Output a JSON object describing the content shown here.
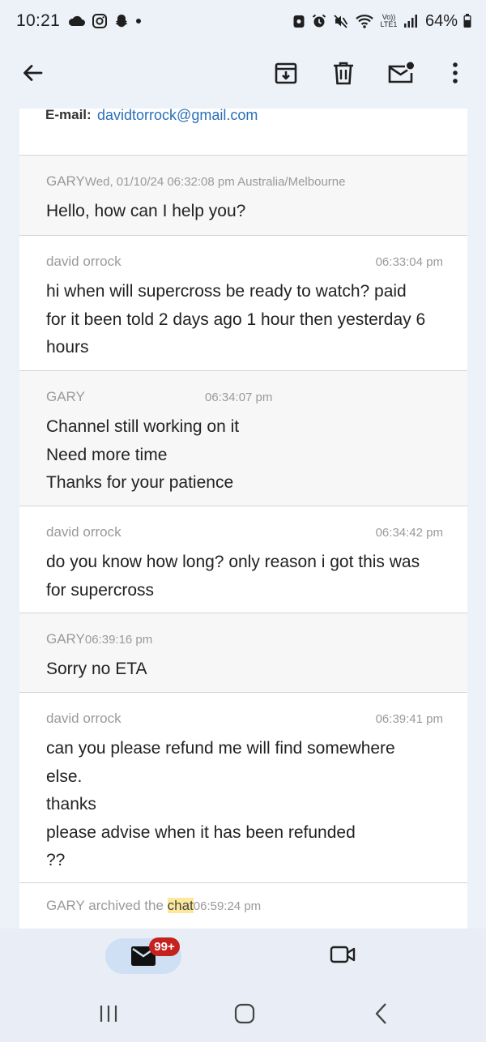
{
  "status_bar": {
    "time": "10:21",
    "battery": "64%",
    "network": "Vo)) LTE1",
    "icons": [
      "cloud-icon",
      "instagram-icon",
      "snapchat-icon",
      "dot-icon",
      "lock-icon",
      "alarm-icon",
      "mute-icon",
      "wifi-icon",
      "signal-icon",
      "battery-icon"
    ]
  },
  "toolbar": {
    "icons": [
      "back-arrow-icon",
      "archive-icon",
      "trash-icon",
      "mark-unread-icon",
      "more-vert-icon"
    ]
  },
  "contact": {
    "email_label": "E-mail:",
    "email_value": "davidtorrock@gmail.com"
  },
  "messages": [
    {
      "sender": "GARY",
      "timestamp": "Wed, 01/10/24 06:32:08 pm Australia/Melbourne",
      "lines": [
        "Hello, how can I help you?"
      ]
    },
    {
      "sender": "david orrock",
      "timestamp": "06:33:04 pm",
      "lines": [
        "hi when will supercross be ready to watch? paid",
        "for it been told 2 days ago 1 hour then yesterday 6",
        "hours"
      ]
    },
    {
      "sender": "GARY",
      "timestamp": "06:34:07 pm",
      "lines": [
        "Channel still working on it",
        "Need more time",
        "Thanks for your patience"
      ]
    },
    {
      "sender": "david orrock",
      "timestamp": "06:34:42 pm",
      "lines": [
        "do you know how long? only reason i got this was",
        "for supercross"
      ]
    },
    {
      "sender": "GARY",
      "timestamp": "06:39:16 pm",
      "lines": [
        "Sorry no ETA"
      ]
    },
    {
      "sender": "david orrock",
      "timestamp": "06:39:41 pm",
      "lines": [
        "can you please refund me will find somewhere",
        "else.",
        "thanks",
        "please advise when it has been refunded",
        "??"
      ]
    }
  ],
  "archived": {
    "text": "GARY archived the ",
    "highlight": "chat",
    "timestamp": "06:59:24 pm"
  },
  "bottom_nav": {
    "mail_badge": "99+",
    "icons": [
      "mail-icon",
      "video-icon"
    ]
  },
  "system_nav": {
    "icons": [
      "recents-icon",
      "home-icon",
      "back-icon"
    ]
  },
  "colors": {
    "background": "#edf1f8",
    "link": "#2a6fb8",
    "highlight": "#fde79b",
    "badge": "#c5221f",
    "nav_pill": "#cfe0f4"
  }
}
